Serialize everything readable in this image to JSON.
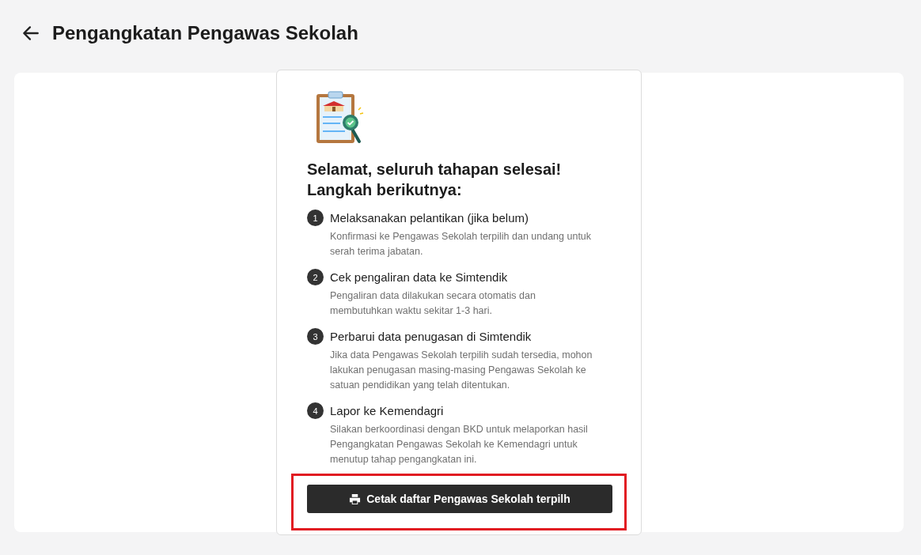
{
  "page": {
    "title": "Pengangkatan Pengawas Sekolah"
  },
  "card": {
    "heading_lines": [
      "Selamat, seluruh tahapan selesai!",
      "Langkah berikutnya:"
    ],
    "steps": [
      {
        "number": "1",
        "title": "Melaksanakan pelantikan (jika belum)",
        "description": "Konfirmasi ke Pengawas Sekolah terpilih dan undang untuk serah terima jabatan."
      },
      {
        "number": "2",
        "title": "Cek pengaliran data ke Simtendik",
        "description": "Pengaliran data dilakukan secara otomatis dan membutuhkan waktu sekitar 1-3 hari."
      },
      {
        "number": "3",
        "title": "Perbarui data penugasan di Simtendik",
        "description": "Jika data Pengawas Sekolah terpilih sudah tersedia, mohon lakukan penugasan masing-masing Pengawas Sekolah ke satuan pendidikan yang telah ditentukan."
      },
      {
        "number": "4",
        "title": "Lapor ke Kemendagri",
        "description": "Silakan berkoordinasi dengan BKD untuk melaporkan hasil Pengangkatan Pengawas Sekolah ke Kemendagri untuk menutup tahap pengangkatan ini."
      }
    ],
    "print_button": {
      "label": "Cetak daftar Pengawas Sekolah terpilh",
      "highlighted": true
    }
  }
}
